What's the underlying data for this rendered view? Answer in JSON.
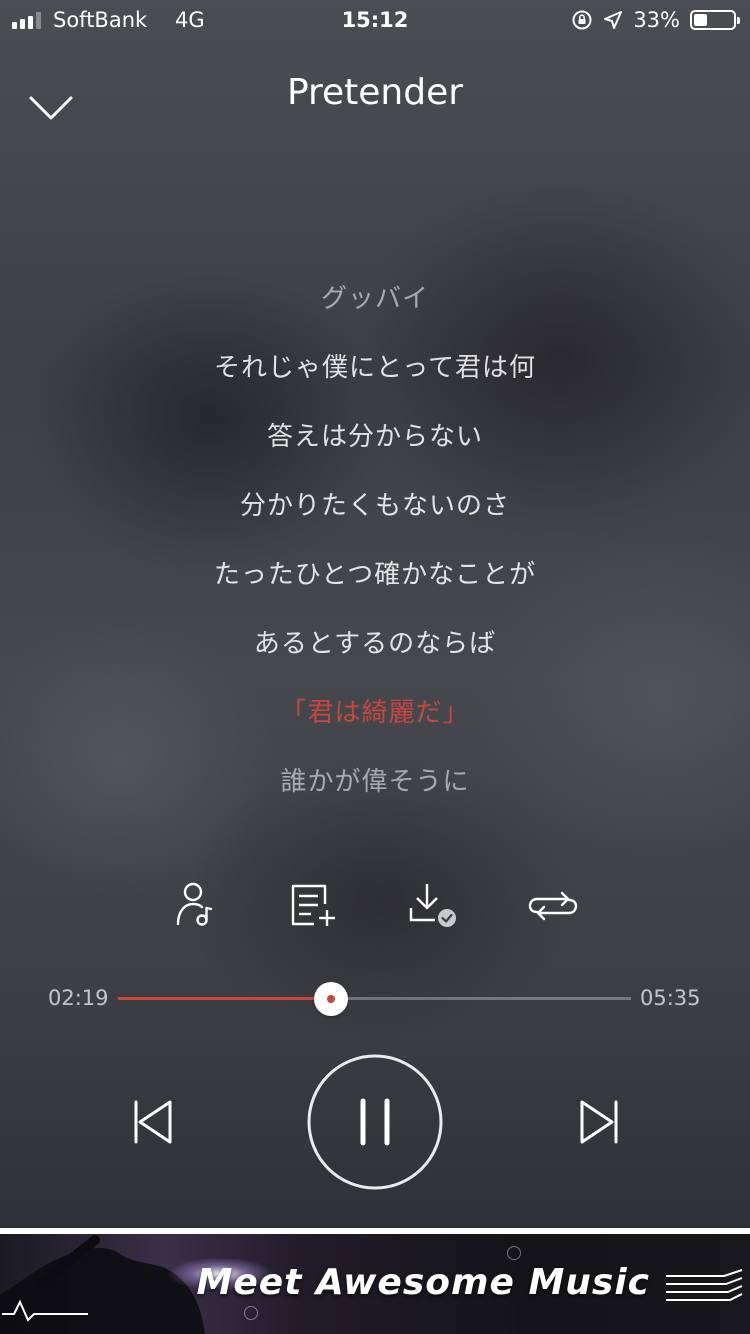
{
  "status_bar": {
    "carrier": "SoftBank",
    "network": "4G",
    "time": "15:12",
    "battery_percent": "33%",
    "battery_level": 0.33,
    "icons": [
      "signal-icon",
      "orientation-lock-icon",
      "location-icon",
      "battery-icon"
    ]
  },
  "header": {
    "title": "Pretender",
    "collapse_icon": "chevron-down-icon"
  },
  "lyrics": {
    "lines": [
      "",
      "グッバイ",
      "それじゃ僕にとって君は何",
      "答えは分からない",
      "分かりたくもないのさ",
      "たったひとつ確かなことが",
      "あるとするのならば",
      "「君は綺麗だ」",
      "誰かが偉そうに"
    ],
    "active_index": 7,
    "active_color": "#c8463d"
  },
  "actions": {
    "icons": [
      "artist-icon",
      "add-to-playlist-icon",
      "downloaded-icon",
      "repeat-icon"
    ]
  },
  "progress": {
    "elapsed": "02:19",
    "duration": "05:35",
    "fraction": 0.415,
    "accent_color": "#c8463d"
  },
  "transport": {
    "icons": [
      "previous-icon",
      "pause-icon",
      "next-icon"
    ]
  },
  "ad": {
    "text": "Meet Awesome Music"
  }
}
